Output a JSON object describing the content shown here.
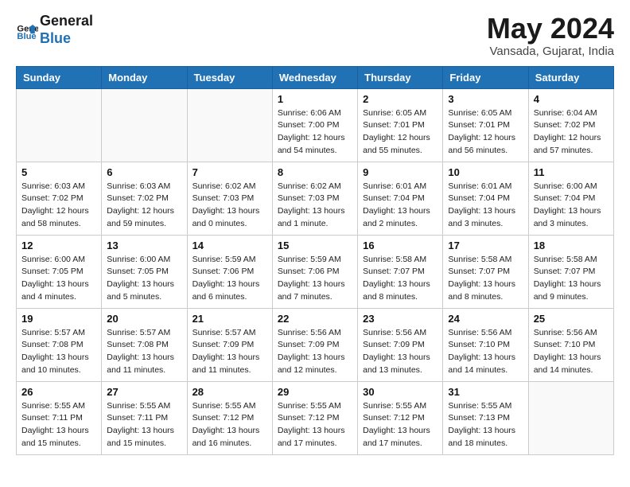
{
  "header": {
    "logo_line1": "General",
    "logo_line2": "Blue",
    "month": "May 2024",
    "location": "Vansada, Gujarat, India"
  },
  "weekdays": [
    "Sunday",
    "Monday",
    "Tuesday",
    "Wednesday",
    "Thursday",
    "Friday",
    "Saturday"
  ],
  "weeks": [
    [
      {
        "day": "",
        "info": ""
      },
      {
        "day": "",
        "info": ""
      },
      {
        "day": "",
        "info": ""
      },
      {
        "day": "1",
        "info": "Sunrise: 6:06 AM\nSunset: 7:00 PM\nDaylight: 12 hours\nand 54 minutes."
      },
      {
        "day": "2",
        "info": "Sunrise: 6:05 AM\nSunset: 7:01 PM\nDaylight: 12 hours\nand 55 minutes."
      },
      {
        "day": "3",
        "info": "Sunrise: 6:05 AM\nSunset: 7:01 PM\nDaylight: 12 hours\nand 56 minutes."
      },
      {
        "day": "4",
        "info": "Sunrise: 6:04 AM\nSunset: 7:02 PM\nDaylight: 12 hours\nand 57 minutes."
      }
    ],
    [
      {
        "day": "5",
        "info": "Sunrise: 6:03 AM\nSunset: 7:02 PM\nDaylight: 12 hours\nand 58 minutes."
      },
      {
        "day": "6",
        "info": "Sunrise: 6:03 AM\nSunset: 7:02 PM\nDaylight: 12 hours\nand 59 minutes."
      },
      {
        "day": "7",
        "info": "Sunrise: 6:02 AM\nSunset: 7:03 PM\nDaylight: 13 hours\nand 0 minutes."
      },
      {
        "day": "8",
        "info": "Sunrise: 6:02 AM\nSunset: 7:03 PM\nDaylight: 13 hours\nand 1 minute."
      },
      {
        "day": "9",
        "info": "Sunrise: 6:01 AM\nSunset: 7:04 PM\nDaylight: 13 hours\nand 2 minutes."
      },
      {
        "day": "10",
        "info": "Sunrise: 6:01 AM\nSunset: 7:04 PM\nDaylight: 13 hours\nand 3 minutes."
      },
      {
        "day": "11",
        "info": "Sunrise: 6:00 AM\nSunset: 7:04 PM\nDaylight: 13 hours\nand 3 minutes."
      }
    ],
    [
      {
        "day": "12",
        "info": "Sunrise: 6:00 AM\nSunset: 7:05 PM\nDaylight: 13 hours\nand 4 minutes."
      },
      {
        "day": "13",
        "info": "Sunrise: 6:00 AM\nSunset: 7:05 PM\nDaylight: 13 hours\nand 5 minutes."
      },
      {
        "day": "14",
        "info": "Sunrise: 5:59 AM\nSunset: 7:06 PM\nDaylight: 13 hours\nand 6 minutes."
      },
      {
        "day": "15",
        "info": "Sunrise: 5:59 AM\nSunset: 7:06 PM\nDaylight: 13 hours\nand 7 minutes."
      },
      {
        "day": "16",
        "info": "Sunrise: 5:58 AM\nSunset: 7:07 PM\nDaylight: 13 hours\nand 8 minutes."
      },
      {
        "day": "17",
        "info": "Sunrise: 5:58 AM\nSunset: 7:07 PM\nDaylight: 13 hours\nand 8 minutes."
      },
      {
        "day": "18",
        "info": "Sunrise: 5:58 AM\nSunset: 7:07 PM\nDaylight: 13 hours\nand 9 minutes."
      }
    ],
    [
      {
        "day": "19",
        "info": "Sunrise: 5:57 AM\nSunset: 7:08 PM\nDaylight: 13 hours\nand 10 minutes."
      },
      {
        "day": "20",
        "info": "Sunrise: 5:57 AM\nSunset: 7:08 PM\nDaylight: 13 hours\nand 11 minutes."
      },
      {
        "day": "21",
        "info": "Sunrise: 5:57 AM\nSunset: 7:09 PM\nDaylight: 13 hours\nand 11 minutes."
      },
      {
        "day": "22",
        "info": "Sunrise: 5:56 AM\nSunset: 7:09 PM\nDaylight: 13 hours\nand 12 minutes."
      },
      {
        "day": "23",
        "info": "Sunrise: 5:56 AM\nSunset: 7:09 PM\nDaylight: 13 hours\nand 13 minutes."
      },
      {
        "day": "24",
        "info": "Sunrise: 5:56 AM\nSunset: 7:10 PM\nDaylight: 13 hours\nand 14 minutes."
      },
      {
        "day": "25",
        "info": "Sunrise: 5:56 AM\nSunset: 7:10 PM\nDaylight: 13 hours\nand 14 minutes."
      }
    ],
    [
      {
        "day": "26",
        "info": "Sunrise: 5:55 AM\nSunset: 7:11 PM\nDaylight: 13 hours\nand 15 minutes."
      },
      {
        "day": "27",
        "info": "Sunrise: 5:55 AM\nSunset: 7:11 PM\nDaylight: 13 hours\nand 15 minutes."
      },
      {
        "day": "28",
        "info": "Sunrise: 5:55 AM\nSunset: 7:12 PM\nDaylight: 13 hours\nand 16 minutes."
      },
      {
        "day": "29",
        "info": "Sunrise: 5:55 AM\nSunset: 7:12 PM\nDaylight: 13 hours\nand 17 minutes."
      },
      {
        "day": "30",
        "info": "Sunrise: 5:55 AM\nSunset: 7:12 PM\nDaylight: 13 hours\nand 17 minutes."
      },
      {
        "day": "31",
        "info": "Sunrise: 5:55 AM\nSunset: 7:13 PM\nDaylight: 13 hours\nand 18 minutes."
      },
      {
        "day": "",
        "info": ""
      }
    ]
  ]
}
